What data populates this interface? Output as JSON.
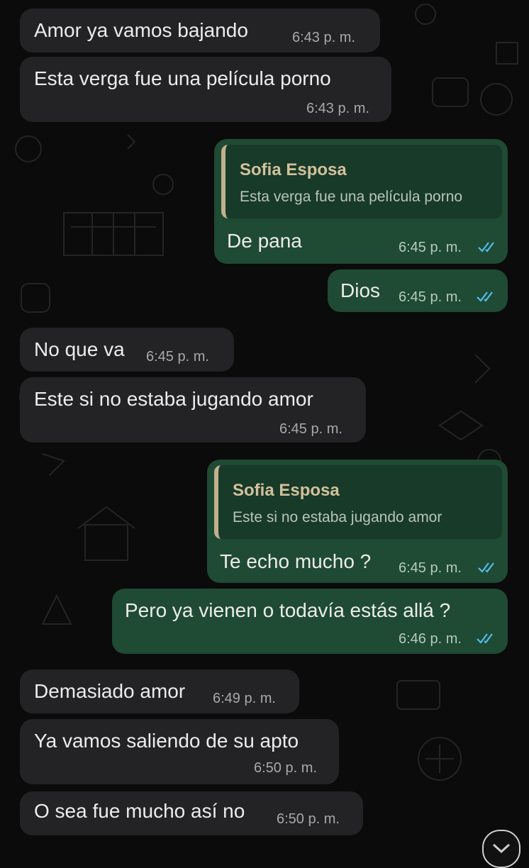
{
  "contact_name": "Sofia Esposa",
  "messages": [
    {
      "dir": "in",
      "text": "Amor ya vamos bajando",
      "time": "6:43 p. m."
    },
    {
      "dir": "in",
      "text": "Esta verga fue una película porno",
      "time": "6:43 p. m."
    },
    {
      "dir": "out",
      "quote_name": "Sofia Esposa",
      "quote_text": "Esta verga fue una película porno",
      "text": "De pana",
      "time": "6:45 p. m.",
      "status": "read"
    },
    {
      "dir": "out",
      "text": "Dios",
      "time": "6:45 p. m.",
      "status": "read"
    },
    {
      "dir": "in",
      "text": "No que va",
      "time": "6:45 p. m."
    },
    {
      "dir": "in",
      "text": "Este si no estaba jugando amor",
      "time": "6:45 p. m."
    },
    {
      "dir": "out",
      "quote_name": "Sofia Esposa",
      "quote_text": "Este si no estaba jugando amor",
      "text": "Te echo mucho ?",
      "time": "6:45 p. m.",
      "status": "read"
    },
    {
      "dir": "out",
      "text": "Pero ya vienen o todavía estás allá ?",
      "time": "6:46 p. m.",
      "status": "read"
    },
    {
      "dir": "in",
      "text": "Demasiado amor",
      "time": "6:49 p. m."
    },
    {
      "dir": "in",
      "text": "Ya vamos saliendo de su apto",
      "time": "6:50 p. m."
    },
    {
      "dir": "in",
      "text": "O sea fue mucho así no",
      "time": "6:50 p. m."
    }
  ],
  "colors": {
    "background": "#0b0b0b",
    "incoming_bubble": "#232325",
    "outgoing_bubble": "#1f4a34",
    "quote_bar": "#c2b08f",
    "read_ticks": "#53bdeb"
  },
  "icons": {
    "read_receipt": "double-check-icon",
    "scroll_button": "chevron-down-icon"
  }
}
